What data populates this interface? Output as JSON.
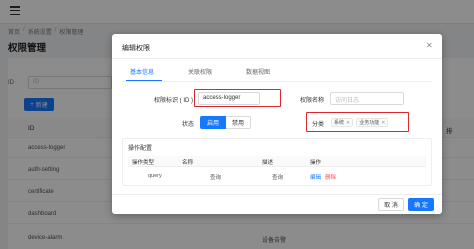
{
  "header": {
    "menu_icon": "hamburger-menu-icon"
  },
  "breadcrumb": [
    "首页",
    "系统设置",
    "权限管理"
  ],
  "page": {
    "title": "权限管理",
    "filter_label": "ID",
    "filter_placeholder": "ID",
    "new_button_label": "新建",
    "table": {
      "header_id": "ID",
      "header_right": "排",
      "rows": [
        "access-logger",
        "auth-setting",
        "certificate",
        "dashboard",
        "device-alarm"
      ],
      "last_row_extra": "设备告警"
    }
  },
  "modal": {
    "title": "编辑权限",
    "tabs": [
      "基本信息",
      "关联权限",
      "数据视图"
    ],
    "active_tab": 0,
    "fields": {
      "id_label": "权限标识 ( ID )",
      "id_value": "access-logger",
      "name_label": "权限名称",
      "name_placeholder": "访问日志",
      "status_label": "状态",
      "status_on": "启用",
      "status_off": "禁用",
      "category_label": "分类",
      "tags": [
        "系统",
        "业务功能"
      ]
    },
    "operations": {
      "title": "操作配置",
      "columns": [
        "操作类型",
        "名称",
        "描述",
        "操作"
      ],
      "rows": [
        {
          "type": "query",
          "name": "查询",
          "desc": "查询",
          "edit": "编辑",
          "delete": "删除"
        }
      ]
    },
    "footer": {
      "cancel": "取 消",
      "ok": "确 定"
    }
  },
  "colors": {
    "primary": "#1677ff",
    "highlight": "#d9272e",
    "danger": "#ff4d4f"
  }
}
